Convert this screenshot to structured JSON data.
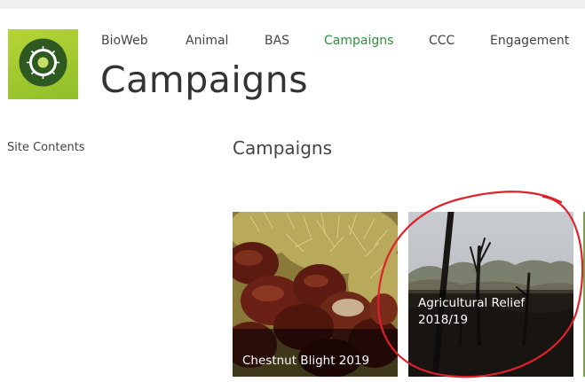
{
  "topnav": {
    "items": [
      {
        "label": "BioWeb"
      },
      {
        "label": "Animal"
      },
      {
        "label": "BAS"
      },
      {
        "label": "Campaigns",
        "active": true
      },
      {
        "label": "CCC"
      },
      {
        "label": "Engagement"
      }
    ]
  },
  "site": {
    "title": "Campaigns"
  },
  "quicklaunch": {
    "items": [
      {
        "label": "Site Contents"
      }
    ]
  },
  "main": {
    "heading": "Campaigns",
    "tiles": [
      {
        "title": "Chestnut Blight 2019",
        "image": "chestnuts-photo"
      },
      {
        "title": "Agricultural Relief 2018/19",
        "image": "burnt-trees-photo",
        "title_lines": [
          "Agricultural Relief",
          "2018/19"
        ]
      }
    ]
  },
  "colors": {
    "accent_green": "#2f8f3e",
    "logo_green": "#a6cb32",
    "annotation_red": "#e0202a"
  }
}
